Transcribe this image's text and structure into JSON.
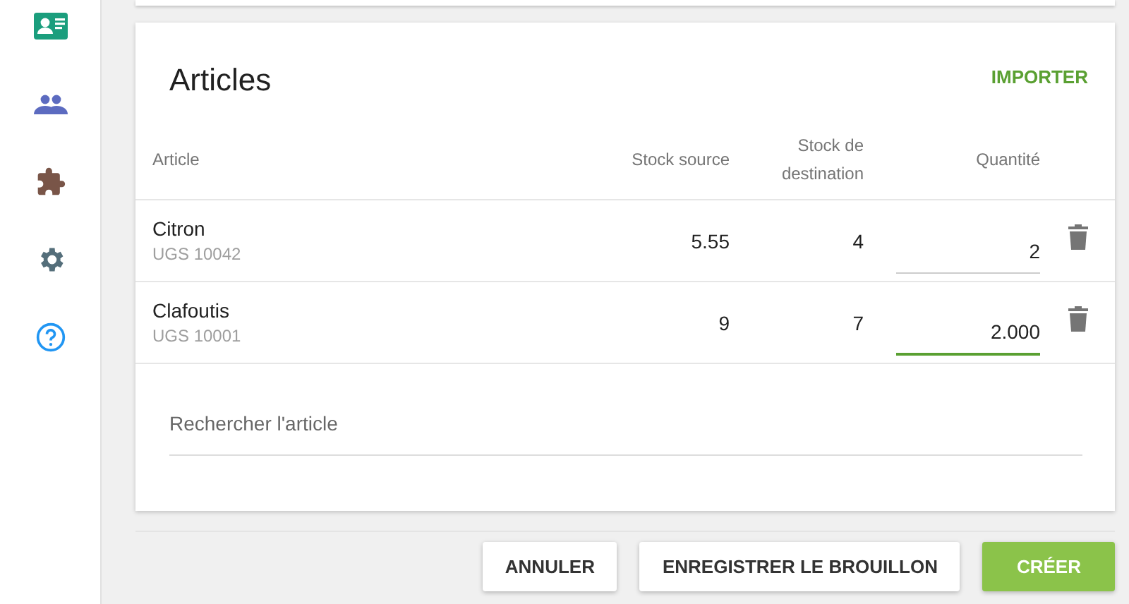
{
  "sidebar": {
    "items": [
      {
        "kind": "contact"
      },
      {
        "kind": "people"
      },
      {
        "kind": "puzzle"
      },
      {
        "kind": "settings"
      },
      {
        "kind": "help"
      }
    ]
  },
  "articles": {
    "title": "Articles",
    "import_label": "IMPORTER",
    "columns": [
      {
        "label": "Article"
      },
      {
        "label": "Stock source"
      },
      {
        "label": "Stock de destination"
      },
      {
        "label": "Quantité"
      }
    ],
    "rows": [
      {
        "name": "Citron",
        "sku": "UGS 10042",
        "stock_source": "5.55",
        "stock_destination": "4",
        "quantity": "2",
        "focused": false
      },
      {
        "name": "Clafoutis",
        "sku": "UGS 10001",
        "stock_source": "9",
        "stock_destination": "7",
        "quantity": "2.000",
        "focused": true
      }
    ],
    "search": {
      "placeholder": "Rechercher l'article"
    }
  },
  "buttons": [
    {
      "label": "ANNULER",
      "kind": "secondary"
    },
    {
      "label": "ENREGISTRER LE BROUILLON",
      "kind": "secondary"
    },
    {
      "label": "CRÉER",
      "kind": "primary"
    }
  ]
}
